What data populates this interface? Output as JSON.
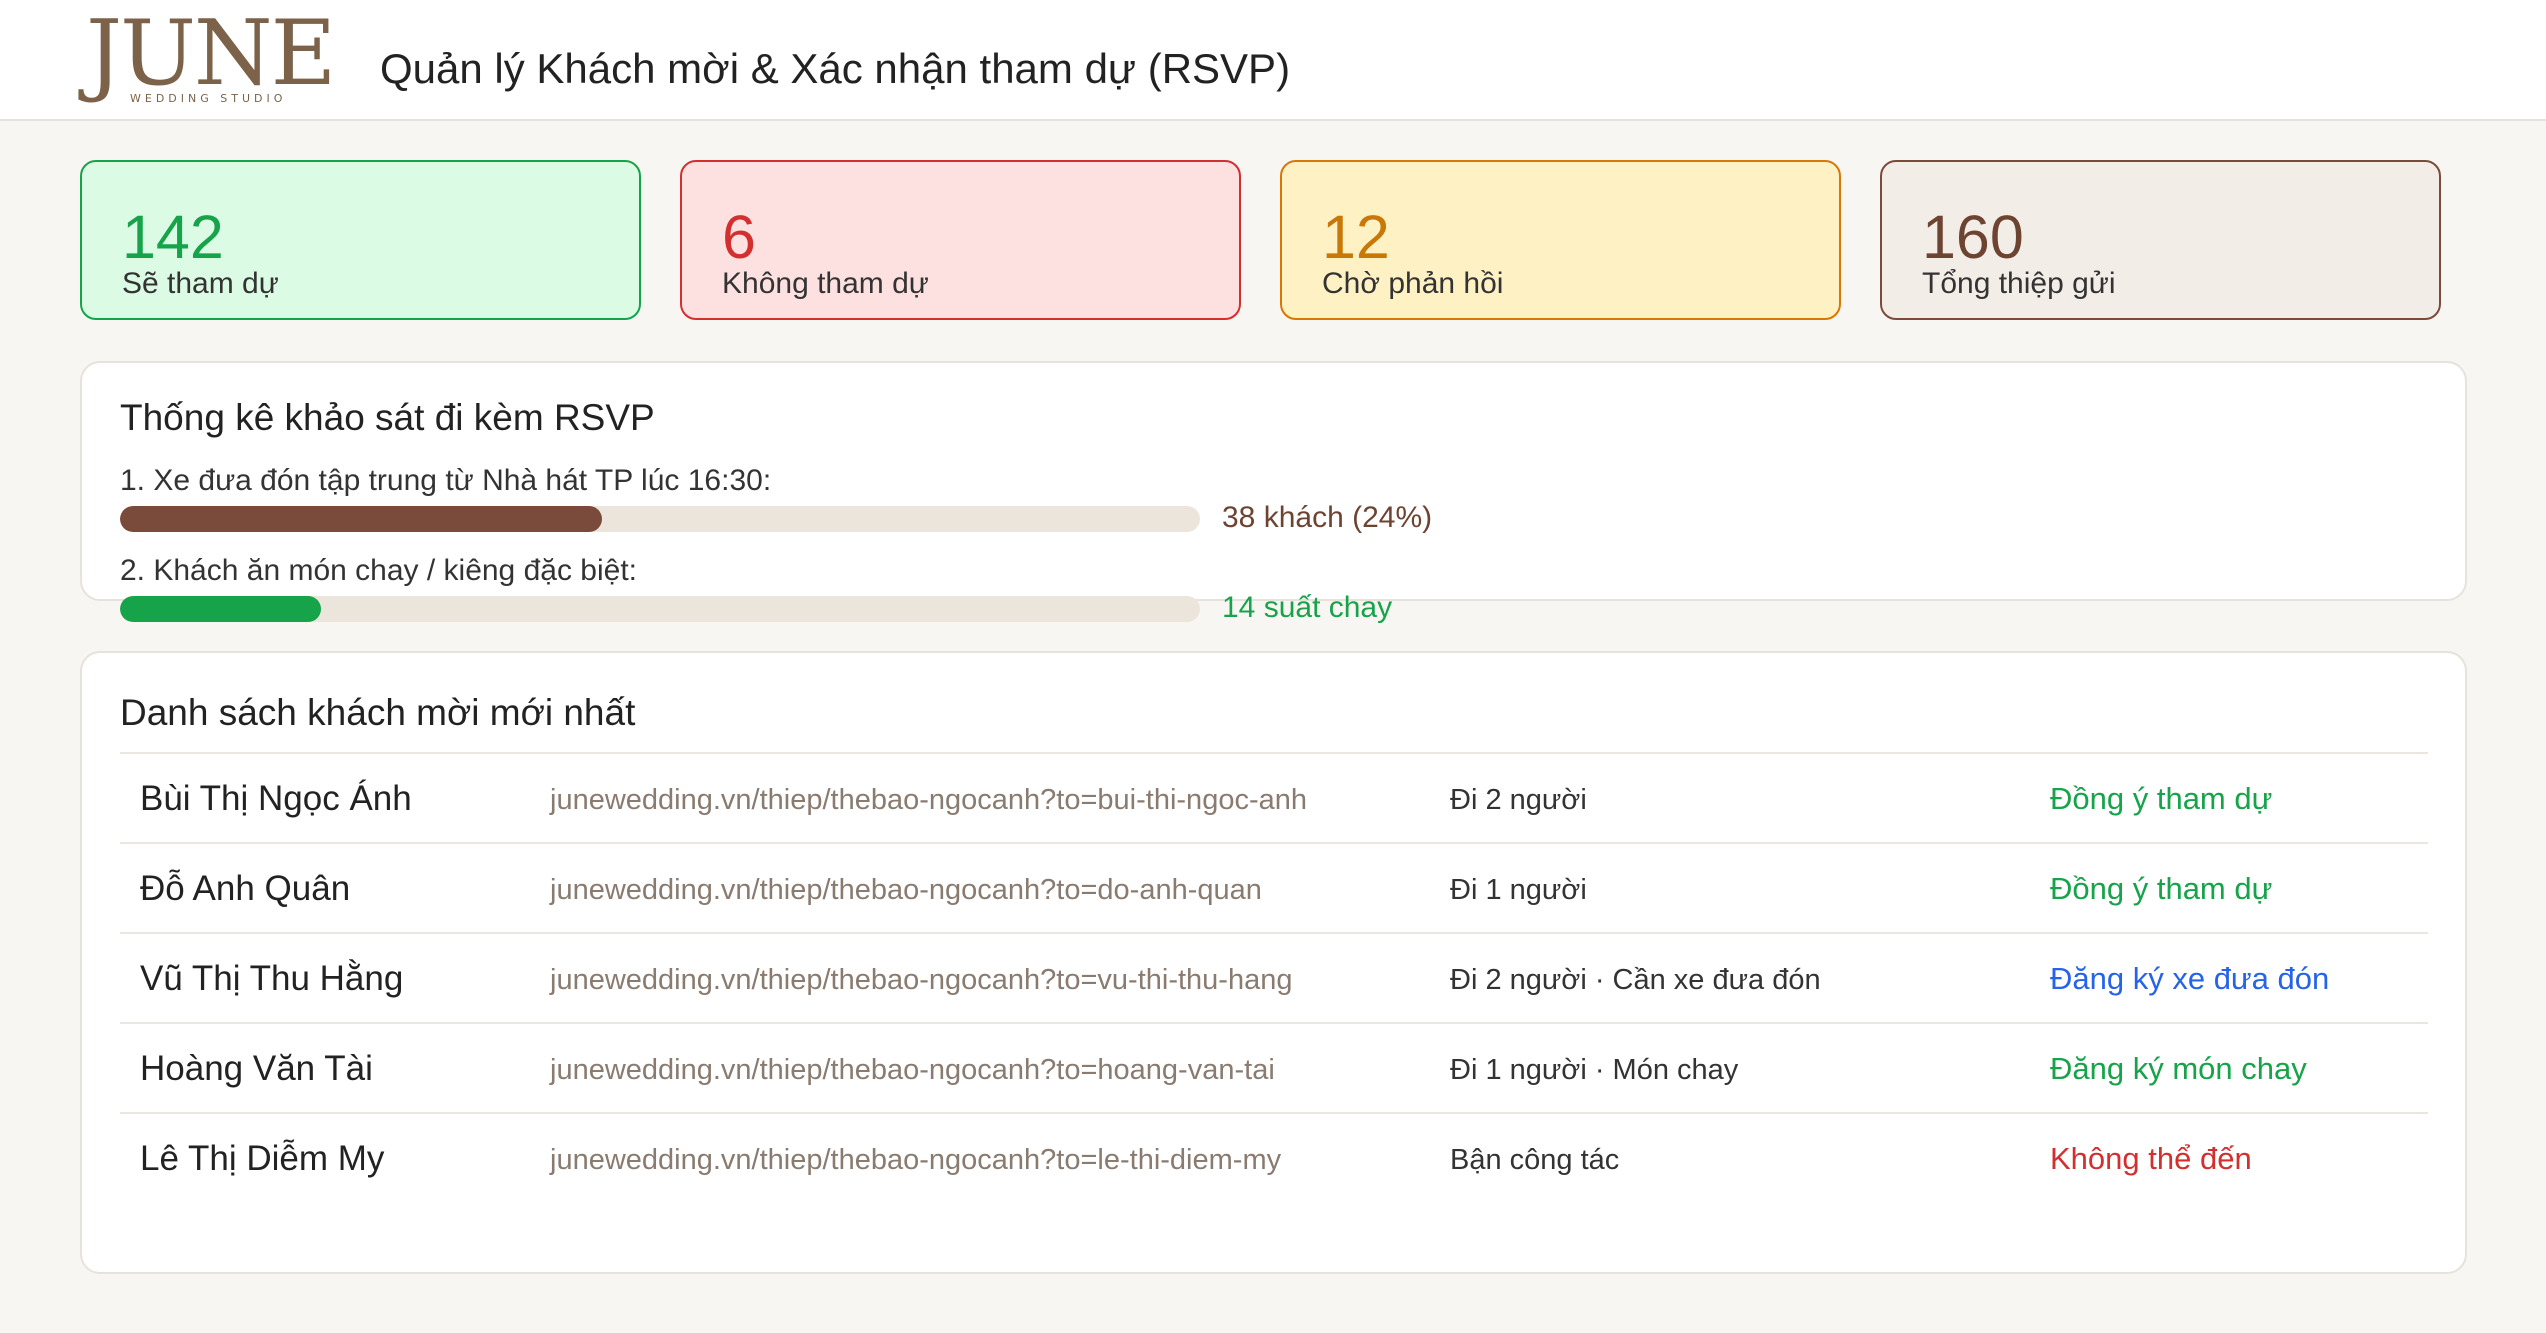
{
  "header": {
    "logo_text": "JUNE",
    "logo_subtext": "WEDDING STUDIO",
    "title": "Quản lý Khách mời & Xác nhận tham dự (RSVP)"
  },
  "stats": [
    {
      "value": "142",
      "label": "Sẽ tham dự",
      "color": "#16a34a"
    },
    {
      "value": "6",
      "label": "Không tham dự",
      "color": "#d32f2f"
    },
    {
      "value": "12",
      "label": "Chờ phản hồi",
      "color": "#d97706"
    },
    {
      "value": "160",
      "label": "Tổng thiệp gửi",
      "color": "#6d4332"
    }
  ],
  "survey": {
    "title": "Thống kê khảo sát đi kèm RSVP",
    "questions": [
      {
        "label": "1. Xe đưa đón tập trung từ Nhà hát TP lúc 16:30:",
        "value_text": "38 khách (24%)",
        "fraction": 0.446,
        "color": "#7a4a3a"
      },
      {
        "label": "2. Khách ăn món chay / kiêng đặc biệt:",
        "value_text": "14 suất chay",
        "fraction": 0.186,
        "color": "#16a34a"
      }
    ]
  },
  "guests": {
    "title": "Danh sách khách mời mới nhất",
    "rows": [
      {
        "name": "Bùi Thị Ngọc Ánh",
        "link": "junewedding.vn/thiep/thebao-ngocanh?to=bui-thi-ngoc-anh",
        "note": "Đi 2 người",
        "status": "Đồng ý tham dự",
        "status_color": "#16a34a"
      },
      {
        "name": "Đỗ Anh Quân",
        "link": "junewedding.vn/thiep/thebao-ngocanh?to=do-anh-quan",
        "note": "Đi 1 người",
        "status": "Đồng ý tham dự",
        "status_color": "#16a34a"
      },
      {
        "name": "Vũ Thị Thu Hằng",
        "link": "junewedding.vn/thiep/thebao-ngocanh?to=vu-thi-thu-hang",
        "note": "Đi 2 người · Cần xe đưa đón",
        "status": "Đăng ký xe đưa đón",
        "status_color": "#2563eb"
      },
      {
        "name": "Hoàng Văn Tài",
        "link": "junewedding.vn/thiep/thebao-ngocanh?to=hoang-van-tai",
        "note": "Đi 1 người · Món chay",
        "status": "Đăng ký món chay",
        "status_color": "#16a34a"
      },
      {
        "name": "Lê Thị Diễm My",
        "link": "junewedding.vn/thiep/thebao-ngocanh?to=le-thi-diem-my",
        "note": "Bận công tác",
        "status": "Không thể đến",
        "status_color": "#d32f2f"
      }
    ]
  }
}
